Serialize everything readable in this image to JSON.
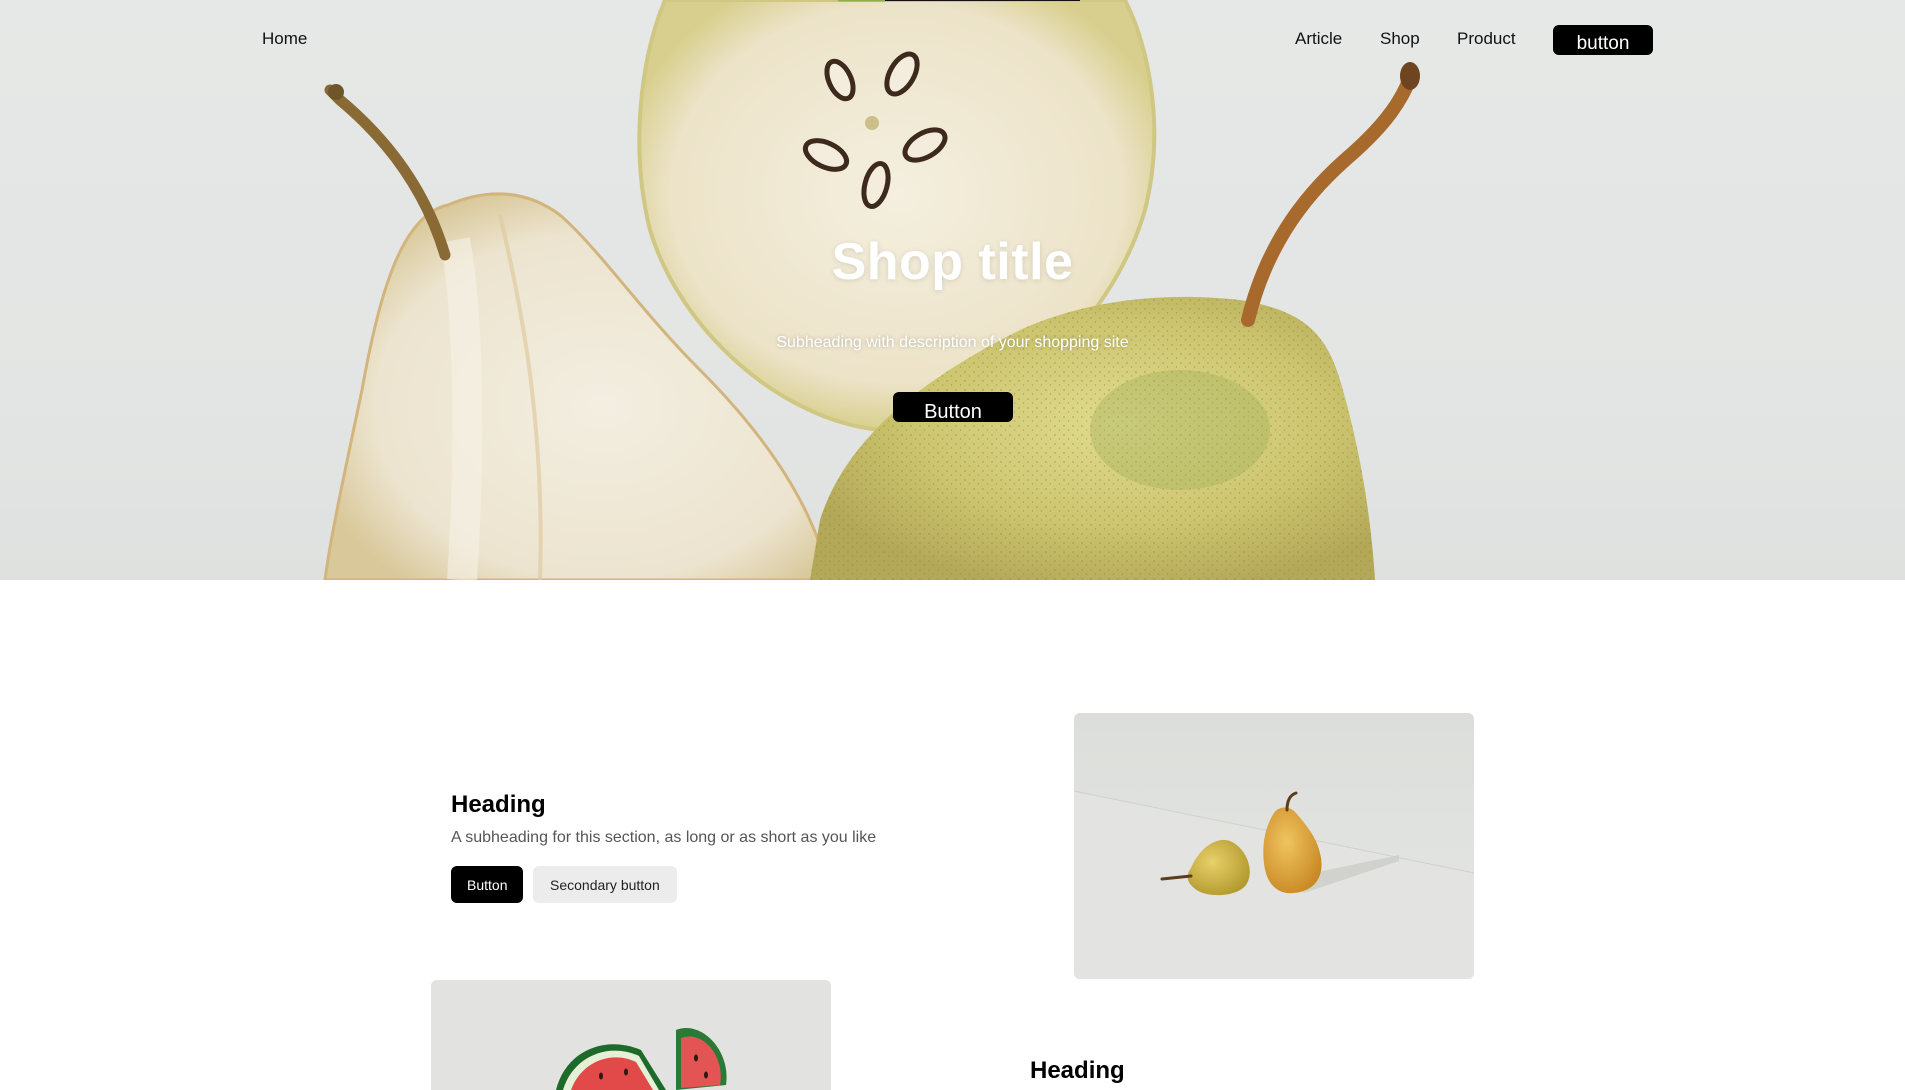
{
  "nav": {
    "home": "Home",
    "links": [
      "Article",
      "Shop",
      "Product"
    ],
    "button": "button"
  },
  "hero": {
    "title": "Shop title",
    "subtitle": "Subheading with description of your shopping site",
    "button": "Button"
  },
  "section1": {
    "heading": "Heading",
    "subheading": "A subheading for this section, as long or as short as you like",
    "primary_button": "Button",
    "secondary_button": "Secondary button",
    "image_alt": "two-pears-photo"
  },
  "section2": {
    "heading": "Heading",
    "image_alt": "watermelon-photo"
  },
  "colors": {
    "primary": "#000000",
    "secondary_bg": "#ececec",
    "hero_bg": "#e4e6e5",
    "pear_green": "#c9cf7a"
  }
}
